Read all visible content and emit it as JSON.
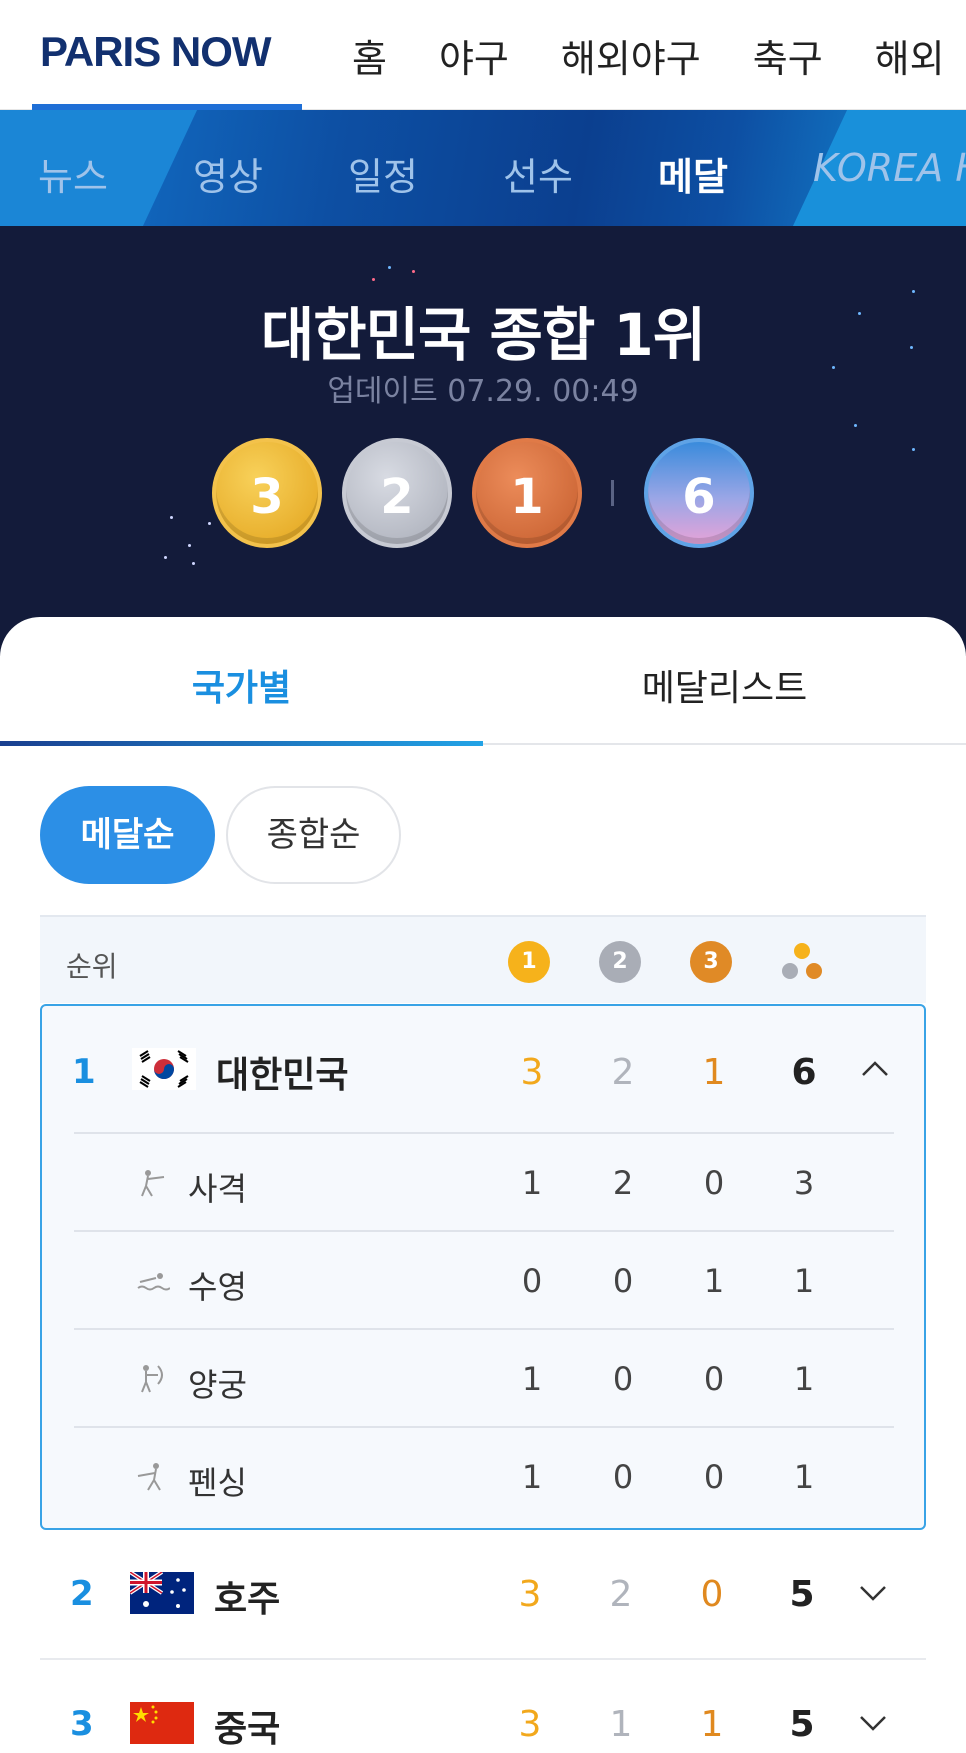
{
  "topnav": {
    "logo": "PARIS NOW",
    "items": [
      "홈",
      "야구",
      "해외야구",
      "축구",
      "해외"
    ]
  },
  "subnav": {
    "items": [
      "뉴스",
      "영상",
      "일정",
      "선수",
      "메달",
      "KOREA H"
    ],
    "active": "메달"
  },
  "hero": {
    "title": "대한민국 종합 1위",
    "update": "업데이트 07.29. 00:49",
    "gold": "3",
    "silver": "2",
    "bronze": "1",
    "total": "6"
  },
  "tabs": {
    "country": "국가별",
    "medalist": "메달리스트"
  },
  "sort": {
    "by_medal": "메달순",
    "by_total": "종합순"
  },
  "table": {
    "header_rank": "순위",
    "header_icons": [
      "1",
      "2",
      "3"
    ],
    "rows": [
      {
        "rank": "1",
        "country": "대한민국",
        "gold": "3",
        "silver": "2",
        "bronze": "1",
        "total": "6",
        "expanded": true,
        "sports": [
          {
            "name": "사격",
            "icon": "shooting-icon",
            "gold": "1",
            "silver": "2",
            "bronze": "0",
            "total": "3"
          },
          {
            "name": "수영",
            "icon": "swimming-icon",
            "gold": "0",
            "silver": "0",
            "bronze": "1",
            "total": "1"
          },
          {
            "name": "양궁",
            "icon": "archery-icon",
            "gold": "1",
            "silver": "0",
            "bronze": "0",
            "total": "1"
          },
          {
            "name": "펜싱",
            "icon": "fencing-icon",
            "gold": "1",
            "silver": "0",
            "bronze": "0",
            "total": "1"
          }
        ]
      },
      {
        "rank": "2",
        "country": "호주",
        "gold": "3",
        "silver": "2",
        "bronze": "0",
        "total": "5",
        "expanded": false
      },
      {
        "rank": "3",
        "country": "중국",
        "gold": "3",
        "silver": "1",
        "bronze": "1",
        "total": "5",
        "expanded": false
      }
    ]
  },
  "colors": {
    "brand_navy": "#12306f",
    "accent_blue": "#1a8fe0",
    "gold": "#f2a81c",
    "silver": "#b0b4bc",
    "bronze": "#e0891f",
    "hero_bg": "#131b3a"
  }
}
